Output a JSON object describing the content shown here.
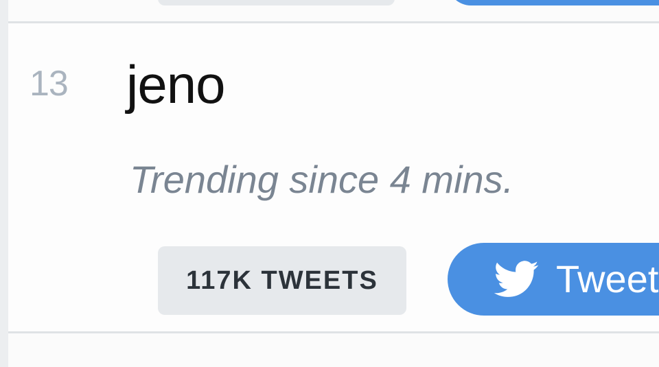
{
  "trend": {
    "rank": "13",
    "name": "jeno",
    "since": "Trending since 4 mins.",
    "tweet_count": "117K TWEETS",
    "tweet_button_label": "Tweet"
  },
  "icons": {
    "tweet_button_icon": "twitter-bird-icon"
  },
  "colors": {
    "accent": "#4a90e2",
    "rank": "#aab4bf",
    "since_text": "#7a8592",
    "count_pill_bg": "#e6e9ec"
  }
}
